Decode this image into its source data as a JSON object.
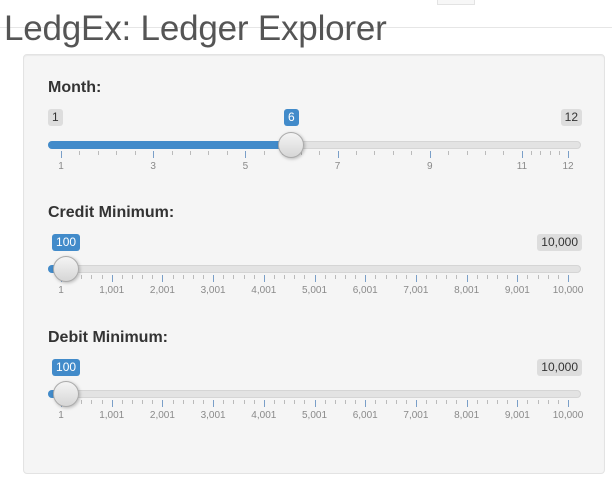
{
  "app": {
    "title": "LedgEx: Ledger Explorer"
  },
  "sliders": [
    {
      "id": "month",
      "label": "Month:",
      "min_label": "1",
      "max_label": "12",
      "value_label": "6",
      "min": 1,
      "max": 12,
      "value": 6,
      "major_ticks": [
        1,
        3,
        5,
        7,
        9,
        11,
        12
      ],
      "major_tick_labels": [
        "1",
        "3",
        "5",
        "7",
        "9",
        "11",
        "12"
      ],
      "minor_per_major": 4
    },
    {
      "id": "credit_min",
      "label": "Credit Minimum:",
      "min_label": "1",
      "max_label": "10,000",
      "value_label": "100",
      "min": 1,
      "max": 10000,
      "value": 100,
      "major_ticks": [
        1,
        1001,
        2001,
        3001,
        4001,
        5001,
        6001,
        7001,
        8001,
        9001,
        10000
      ],
      "major_tick_labels": [
        "1",
        "1,001",
        "2,001",
        "3,001",
        "4,001",
        "5,001",
        "6,001",
        "7,001",
        "8,001",
        "9,001",
        "10,000"
      ],
      "minor_per_major": 4
    },
    {
      "id": "debit_min",
      "label": "Debit Minimum:",
      "min_label": "1",
      "max_label": "10,000",
      "value_label": "100",
      "min": 1,
      "max": 10000,
      "value": 100,
      "major_ticks": [
        1,
        1001,
        2001,
        3001,
        4001,
        5001,
        6001,
        7001,
        8001,
        9001,
        10000
      ],
      "major_tick_labels": [
        "1",
        "1,001",
        "2,001",
        "3,001",
        "4,001",
        "5,001",
        "6,001",
        "7,001",
        "8,001",
        "9,001",
        "10,000"
      ],
      "minor_per_major": 4
    }
  ],
  "colors": {
    "accent": "#428bca",
    "panel_bg": "#f5f5f5",
    "badge_grey": "#dddddd"
  }
}
